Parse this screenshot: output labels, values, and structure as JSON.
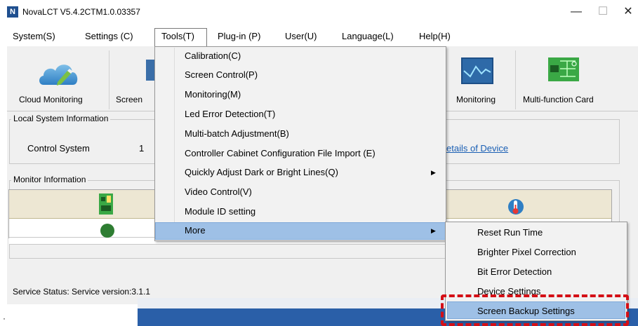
{
  "window": {
    "title": "NovaLCT V5.4.2CTM1.0.03357",
    "app_icon": "N",
    "minimize_glyph": "—",
    "maximize_glyph": "☐",
    "close_glyph": "✕"
  },
  "menubar": {
    "system": "System(S)",
    "settings": "Settings (C)",
    "tools": "Tools(T)",
    "plugin": "Plug-in (P)",
    "user": "User(U)",
    "language": "Language(L)",
    "help": "Help(H)"
  },
  "toolbar": {
    "cloud_monitoring": "Cloud Monitoring",
    "screen": "Screen",
    "monitoring": "Monitoring",
    "multifunction_card": "Multi-function Card"
  },
  "local_system": {
    "title": "Local System Information",
    "control_system_label": "Control System",
    "control_system_value": "1",
    "details_link": "etails of Device"
  },
  "monitor": {
    "title": "Monitor Information"
  },
  "status": {
    "text": "Service Status:  Service version:3.1.1"
  },
  "tools_menu": {
    "items": [
      "Calibration(C)",
      "Screen Control(P)",
      "Monitoring(M)",
      "Led Error Detection(T)",
      "Multi-batch Adjustment(B)",
      "Controller Cabinet Configuration File Import (E)",
      "Quickly Adjust Dark or Bright Lines(Q)",
      "Video Control(V)",
      "Module ID setting",
      "More"
    ]
  },
  "more_menu": {
    "items": [
      "Reset Run Time",
      "Brighter Pixel Correction",
      "Bit Error Detection",
      "Device Settings",
      "Screen Backup Settings"
    ]
  },
  "colors": {
    "highlight": "#9ec0e6",
    "annotation": "#d40f16",
    "status_ok": "#2e7d32"
  },
  "icons": {
    "cloud": "cloud-pencil-icon",
    "screen": "monitor-icon",
    "monitoring": "waveform-monitor-icon",
    "card": "circuit-board-icon",
    "chip": "chip-icon",
    "thermometer": "thermometer-icon",
    "status": "status-dot-icon",
    "submenu_arrow": "chevron-right-icon"
  }
}
